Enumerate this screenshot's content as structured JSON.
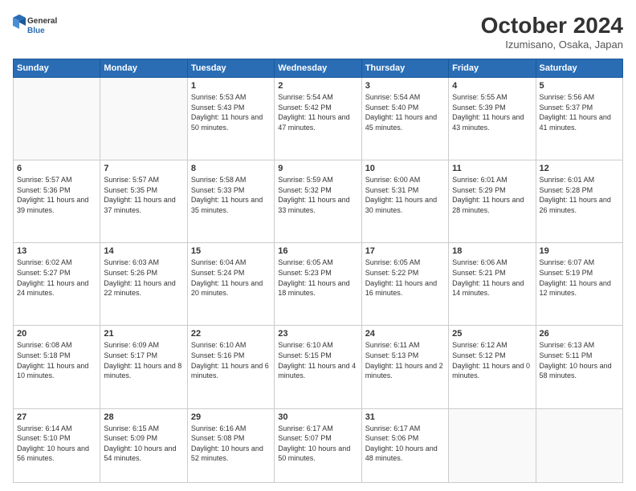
{
  "logo": {
    "line1": "General",
    "line2": "Blue"
  },
  "title": "October 2024",
  "location": "Izumisano, Osaka, Japan",
  "headers": [
    "Sunday",
    "Monday",
    "Tuesday",
    "Wednesday",
    "Thursday",
    "Friday",
    "Saturday"
  ],
  "weeks": [
    [
      {
        "day": "",
        "info": ""
      },
      {
        "day": "",
        "info": ""
      },
      {
        "day": "1",
        "info": "Sunrise: 5:53 AM\nSunset: 5:43 PM\nDaylight: 11 hours and 50 minutes."
      },
      {
        "day": "2",
        "info": "Sunrise: 5:54 AM\nSunset: 5:42 PM\nDaylight: 11 hours and 47 minutes."
      },
      {
        "day": "3",
        "info": "Sunrise: 5:54 AM\nSunset: 5:40 PM\nDaylight: 11 hours and 45 minutes."
      },
      {
        "day": "4",
        "info": "Sunrise: 5:55 AM\nSunset: 5:39 PM\nDaylight: 11 hours and 43 minutes."
      },
      {
        "day": "5",
        "info": "Sunrise: 5:56 AM\nSunset: 5:37 PM\nDaylight: 11 hours and 41 minutes."
      }
    ],
    [
      {
        "day": "6",
        "info": "Sunrise: 5:57 AM\nSunset: 5:36 PM\nDaylight: 11 hours and 39 minutes."
      },
      {
        "day": "7",
        "info": "Sunrise: 5:57 AM\nSunset: 5:35 PM\nDaylight: 11 hours and 37 minutes."
      },
      {
        "day": "8",
        "info": "Sunrise: 5:58 AM\nSunset: 5:33 PM\nDaylight: 11 hours and 35 minutes."
      },
      {
        "day": "9",
        "info": "Sunrise: 5:59 AM\nSunset: 5:32 PM\nDaylight: 11 hours and 33 minutes."
      },
      {
        "day": "10",
        "info": "Sunrise: 6:00 AM\nSunset: 5:31 PM\nDaylight: 11 hours and 30 minutes."
      },
      {
        "day": "11",
        "info": "Sunrise: 6:01 AM\nSunset: 5:29 PM\nDaylight: 11 hours and 28 minutes."
      },
      {
        "day": "12",
        "info": "Sunrise: 6:01 AM\nSunset: 5:28 PM\nDaylight: 11 hours and 26 minutes."
      }
    ],
    [
      {
        "day": "13",
        "info": "Sunrise: 6:02 AM\nSunset: 5:27 PM\nDaylight: 11 hours and 24 minutes."
      },
      {
        "day": "14",
        "info": "Sunrise: 6:03 AM\nSunset: 5:26 PM\nDaylight: 11 hours and 22 minutes."
      },
      {
        "day": "15",
        "info": "Sunrise: 6:04 AM\nSunset: 5:24 PM\nDaylight: 11 hours and 20 minutes."
      },
      {
        "day": "16",
        "info": "Sunrise: 6:05 AM\nSunset: 5:23 PM\nDaylight: 11 hours and 18 minutes."
      },
      {
        "day": "17",
        "info": "Sunrise: 6:05 AM\nSunset: 5:22 PM\nDaylight: 11 hours and 16 minutes."
      },
      {
        "day": "18",
        "info": "Sunrise: 6:06 AM\nSunset: 5:21 PM\nDaylight: 11 hours and 14 minutes."
      },
      {
        "day": "19",
        "info": "Sunrise: 6:07 AM\nSunset: 5:19 PM\nDaylight: 11 hours and 12 minutes."
      }
    ],
    [
      {
        "day": "20",
        "info": "Sunrise: 6:08 AM\nSunset: 5:18 PM\nDaylight: 11 hours and 10 minutes."
      },
      {
        "day": "21",
        "info": "Sunrise: 6:09 AM\nSunset: 5:17 PM\nDaylight: 11 hours and 8 minutes."
      },
      {
        "day": "22",
        "info": "Sunrise: 6:10 AM\nSunset: 5:16 PM\nDaylight: 11 hours and 6 minutes."
      },
      {
        "day": "23",
        "info": "Sunrise: 6:10 AM\nSunset: 5:15 PM\nDaylight: 11 hours and 4 minutes."
      },
      {
        "day": "24",
        "info": "Sunrise: 6:11 AM\nSunset: 5:13 PM\nDaylight: 11 hours and 2 minutes."
      },
      {
        "day": "25",
        "info": "Sunrise: 6:12 AM\nSunset: 5:12 PM\nDaylight: 11 hours and 0 minutes."
      },
      {
        "day": "26",
        "info": "Sunrise: 6:13 AM\nSunset: 5:11 PM\nDaylight: 10 hours and 58 minutes."
      }
    ],
    [
      {
        "day": "27",
        "info": "Sunrise: 6:14 AM\nSunset: 5:10 PM\nDaylight: 10 hours and 56 minutes."
      },
      {
        "day": "28",
        "info": "Sunrise: 6:15 AM\nSunset: 5:09 PM\nDaylight: 10 hours and 54 minutes."
      },
      {
        "day": "29",
        "info": "Sunrise: 6:16 AM\nSunset: 5:08 PM\nDaylight: 10 hours and 52 minutes."
      },
      {
        "day": "30",
        "info": "Sunrise: 6:17 AM\nSunset: 5:07 PM\nDaylight: 10 hours and 50 minutes."
      },
      {
        "day": "31",
        "info": "Sunrise: 6:17 AM\nSunset: 5:06 PM\nDaylight: 10 hours and 48 minutes."
      },
      {
        "day": "",
        "info": ""
      },
      {
        "day": "",
        "info": ""
      }
    ]
  ]
}
